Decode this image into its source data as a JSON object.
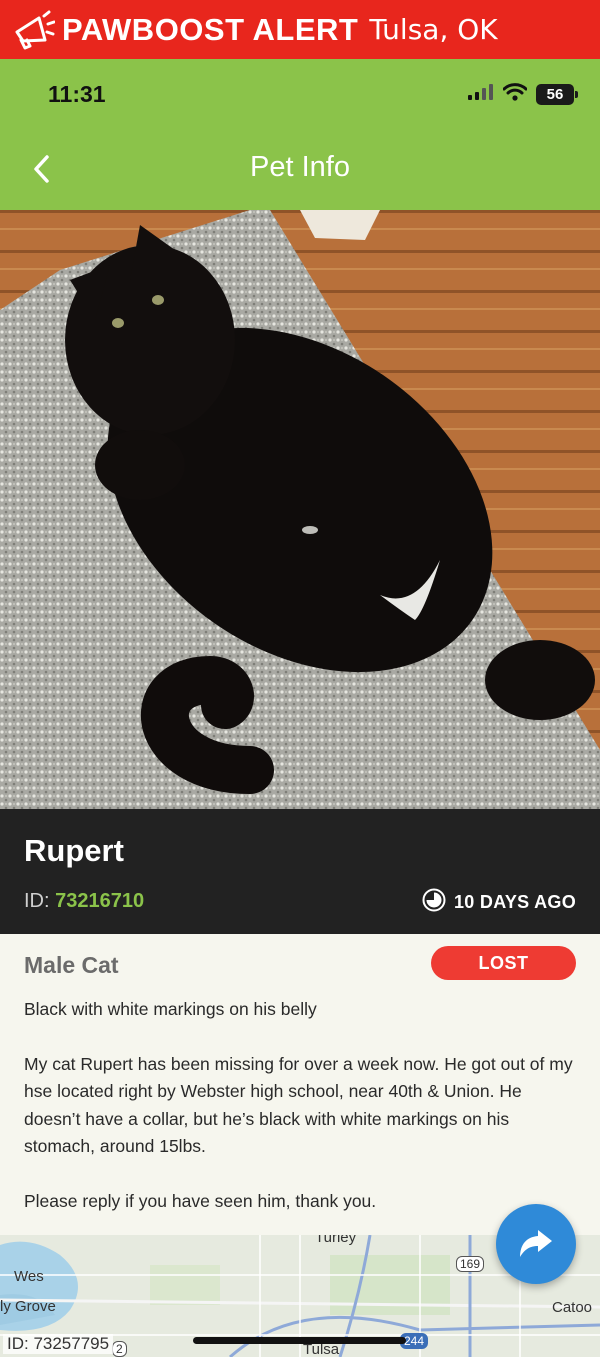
{
  "alert": {
    "brand": "PAWBOOST ALERT",
    "city": "Tulsa, OK",
    "icon": "megaphone-icon",
    "bg_color": "#e8261d"
  },
  "status_bar": {
    "time": "11:31",
    "battery": "56"
  },
  "nav": {
    "title": "Pet Info",
    "back_icon": "chevron-left-icon",
    "bg_color": "#8bc34a"
  },
  "pet": {
    "name": "Rupert",
    "id_label": "ID:",
    "id": "73216710",
    "posted_ago": "10 DAYS AGO",
    "sex_type": "Male Cat",
    "status": "LOST",
    "summary": "Black with white markings on his belly",
    "description": "My cat Rupert has been missing for over a week now. He got out of my hse located right by Webster high school, near 40th & Union. He doesn’t have a collar, but he’s black with white markings on his stomach, around 15lbs.",
    "closing": "Please reply if you have seen him, thank you."
  },
  "map": {
    "labels": {
      "turley": "Turley",
      "west": "Wes",
      "grove": "ly Grove",
      "catoosa": "Catoo",
      "tulsa": "Tulsa"
    },
    "shields": {
      "us169": "169",
      "i244": "244",
      "r2": "2"
    }
  },
  "footer": {
    "id_text": "ID: 73257795"
  },
  "colors": {
    "accent_green": "#8bc34a",
    "lost_red": "#ee3b33",
    "share_blue": "#2f8ad8",
    "dark_band": "#222222"
  }
}
